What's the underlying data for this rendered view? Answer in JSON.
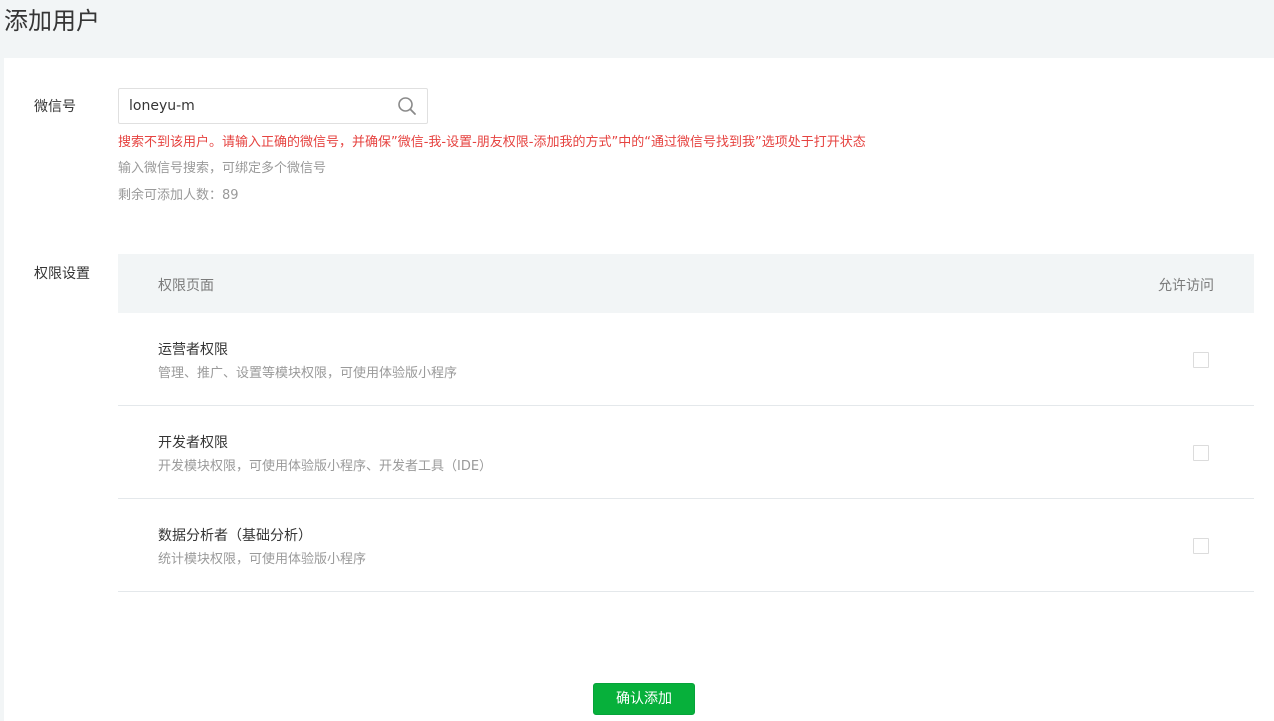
{
  "page": {
    "title": "添加用户"
  },
  "wechat_field": {
    "label": "微信号",
    "value": "loneyu-m",
    "error": "搜索不到该用户。请输入正确的微信号，并确保”微信-我-设置-朋友权限-添加我的方式”中的“通过微信号找到我”选项处于打开状态",
    "hint": "输入微信号搜索，可绑定多个微信号",
    "remaining": "剩余可添加人数：89"
  },
  "permissions": {
    "label": "权限设置",
    "header": {
      "page_col": "权限页面",
      "allow_col": "允许访问"
    },
    "rows": [
      {
        "title": "运营者权限",
        "desc": "管理、推广、设置等模块权限，可使用体验版小程序",
        "checked": false
      },
      {
        "title": "开发者权限",
        "desc": "开发模块权限，可使用体验版小程序、开发者工具（IDE）",
        "checked": false
      },
      {
        "title": "数据分析者（基础分析）",
        "desc": "统计模块权限，可使用体验版小程序",
        "checked": false
      }
    ]
  },
  "actions": {
    "confirm_label": "确认添加"
  },
  "colors": {
    "accent": "#07b03b",
    "error": "#e64340"
  }
}
